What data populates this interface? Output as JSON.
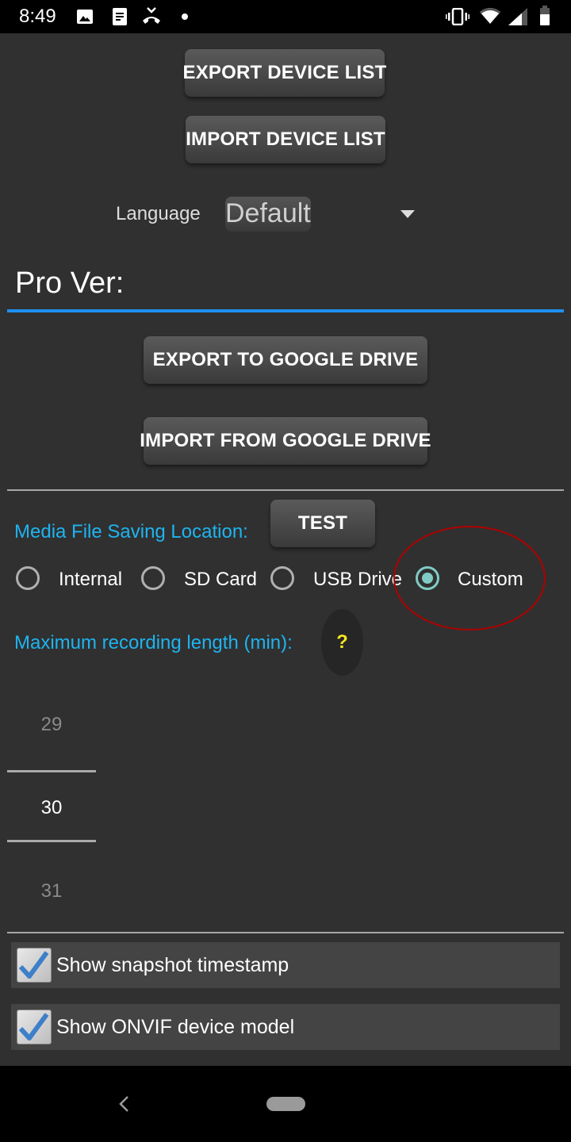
{
  "status_bar": {
    "time": "8:49",
    "left_icons": [
      "image-icon",
      "document-icon",
      "missed-call-icon",
      "dot-icon"
    ],
    "right_icons": [
      "vibrate-icon",
      "wifi-icon",
      "cellular-signal-icon",
      "battery-icon"
    ]
  },
  "buttons": {
    "export_device_list": "EXPORT DEVICE LIST",
    "import_device_list": "IMPORT DEVICE LIST",
    "export_google_drive": "EXPORT TO GOOGLE DRIVE",
    "import_google_drive": "IMPORT FROM GOOGLE DRIVE",
    "test": "TEST"
  },
  "language": {
    "label": "Language",
    "selected": "Default"
  },
  "pro_version": {
    "label": "Pro Ver:"
  },
  "media_location": {
    "label": "Media File Saving Location:",
    "options": [
      {
        "label": "Internal",
        "checked": false
      },
      {
        "label": "SD Card",
        "checked": false
      },
      {
        "label": "USB Drive",
        "checked": false
      },
      {
        "label": "Custom",
        "checked": true
      }
    ],
    "annotation_color": "#b00000"
  },
  "max_recording": {
    "label": "Maximum recording length (min):",
    "help": "?",
    "picker": {
      "previous": "29",
      "selected": "30",
      "next": "31"
    }
  },
  "checkboxes": [
    {
      "label": "Show snapshot timestamp",
      "checked": true
    },
    {
      "label": "Show ONVIF device model",
      "checked": true
    }
  ],
  "colors": {
    "accent_blue": "#1eb4f0",
    "underline_blue": "#1e8ff0",
    "radio_checked": "#80cbc4",
    "help_yellow": "#f5e61e"
  }
}
